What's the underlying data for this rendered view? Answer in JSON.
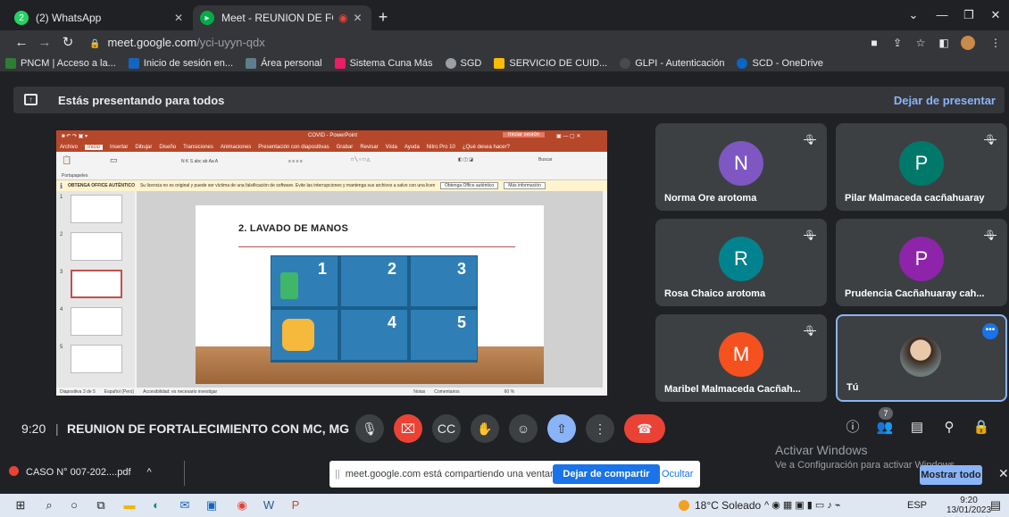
{
  "browser": {
    "tabs": [
      {
        "label": "(2) WhatsApp",
        "badge": "2"
      },
      {
        "label": "Meet - REUNION DE FORTAL"
      }
    ],
    "address": {
      "host": "meet.google.com",
      "path": "/yci-uyyn-qdx"
    },
    "bookmarks": [
      "PNCM | Acceso a la...",
      "Inicio de sesión en...",
      "Área personal",
      "Sistema Cuna Más",
      "SGD",
      "SERVICIO DE CUID...",
      "GLPI - Autenticación",
      "SCD - OneDrive"
    ]
  },
  "banner": {
    "text": "Estás presentando para todos",
    "stop_label": "Dejar de presentar"
  },
  "slide": {
    "app_title": "COVID - PowerPoint",
    "ribbon_tabs": [
      "Archivo",
      "Inicio",
      "Insertar",
      "Dibujar",
      "Diseño",
      "Transiciones",
      "Animaciones",
      "Presentación con diapositivas",
      "Grabar",
      "Revisar",
      "Vista",
      "Ayuda",
      "Nitro Pro 10",
      "¿Qué desea hacer?"
    ],
    "message_title": "OBTENGA OFFICE AUTÉNTICO",
    "message_text": "Su licencia no es original y puede ser víctima de una falsificación de software. Evite las interrupciones y mantenga sus archivos a salvo con una licencia original de Office hoy mismo.",
    "message_btn1": "Obtenga Office auténtico",
    "message_btn2": "Más información",
    "title": "2. LAVADO DE MANOS",
    "step_numbers": [
      "1",
      "2",
      "3",
      "4",
      "5"
    ],
    "status": "Diapositiva 3 de 5",
    "status_lang": "Español (Perú)",
    "status_access": "Accesibilidad: es necesario investigar",
    "status_notes": "Notas",
    "status_comments": "Comentarios",
    "zoom": "60 %",
    "thumb_numbers": [
      "1",
      "2",
      "3",
      "4",
      "5"
    ]
  },
  "participants": [
    {
      "name": "Norma Ore arotoma",
      "initial": "N",
      "color": "#7e57c2",
      "muted": true
    },
    {
      "name": "Pilar Malmaceda cacñahuaray",
      "initial": "P",
      "color": "#00796b",
      "muted": true
    },
    {
      "name": "Rosa Chaico arotoma",
      "initial": "R",
      "color": "#00838f",
      "muted": true
    },
    {
      "name": "Prudencia Cacñahuaray cah...",
      "initial": "P",
      "color": "#8e24aa",
      "muted": true
    },
    {
      "name": "Maribel Malmaceda Cacñah...",
      "initial": "M",
      "color": "#f4511e",
      "muted": true
    },
    {
      "name": "Tú",
      "initial": "",
      "color": "#3c4043",
      "muted": false
    }
  ],
  "controls": {
    "time": "9:20",
    "meeting_name": "REUNION DE FORTALECIMIENTO CON MC, MG",
    "participant_count": "7"
  },
  "watermark": {
    "line1": "Activar Windows",
    "line2": "Ve a Configuración para activar Windows."
  },
  "download": {
    "file": "CASO N° 007-202....pdf",
    "share_text": "meet.google.com está compartiendo una ventana.",
    "share_stop": "Dejar de compartir",
    "hide": "Ocultar",
    "show_all": "Mostrar todo"
  },
  "taskbar": {
    "weather": "18°C Soleado",
    "lang": "ESP",
    "time": "9:20",
    "date": "13/01/2023"
  }
}
